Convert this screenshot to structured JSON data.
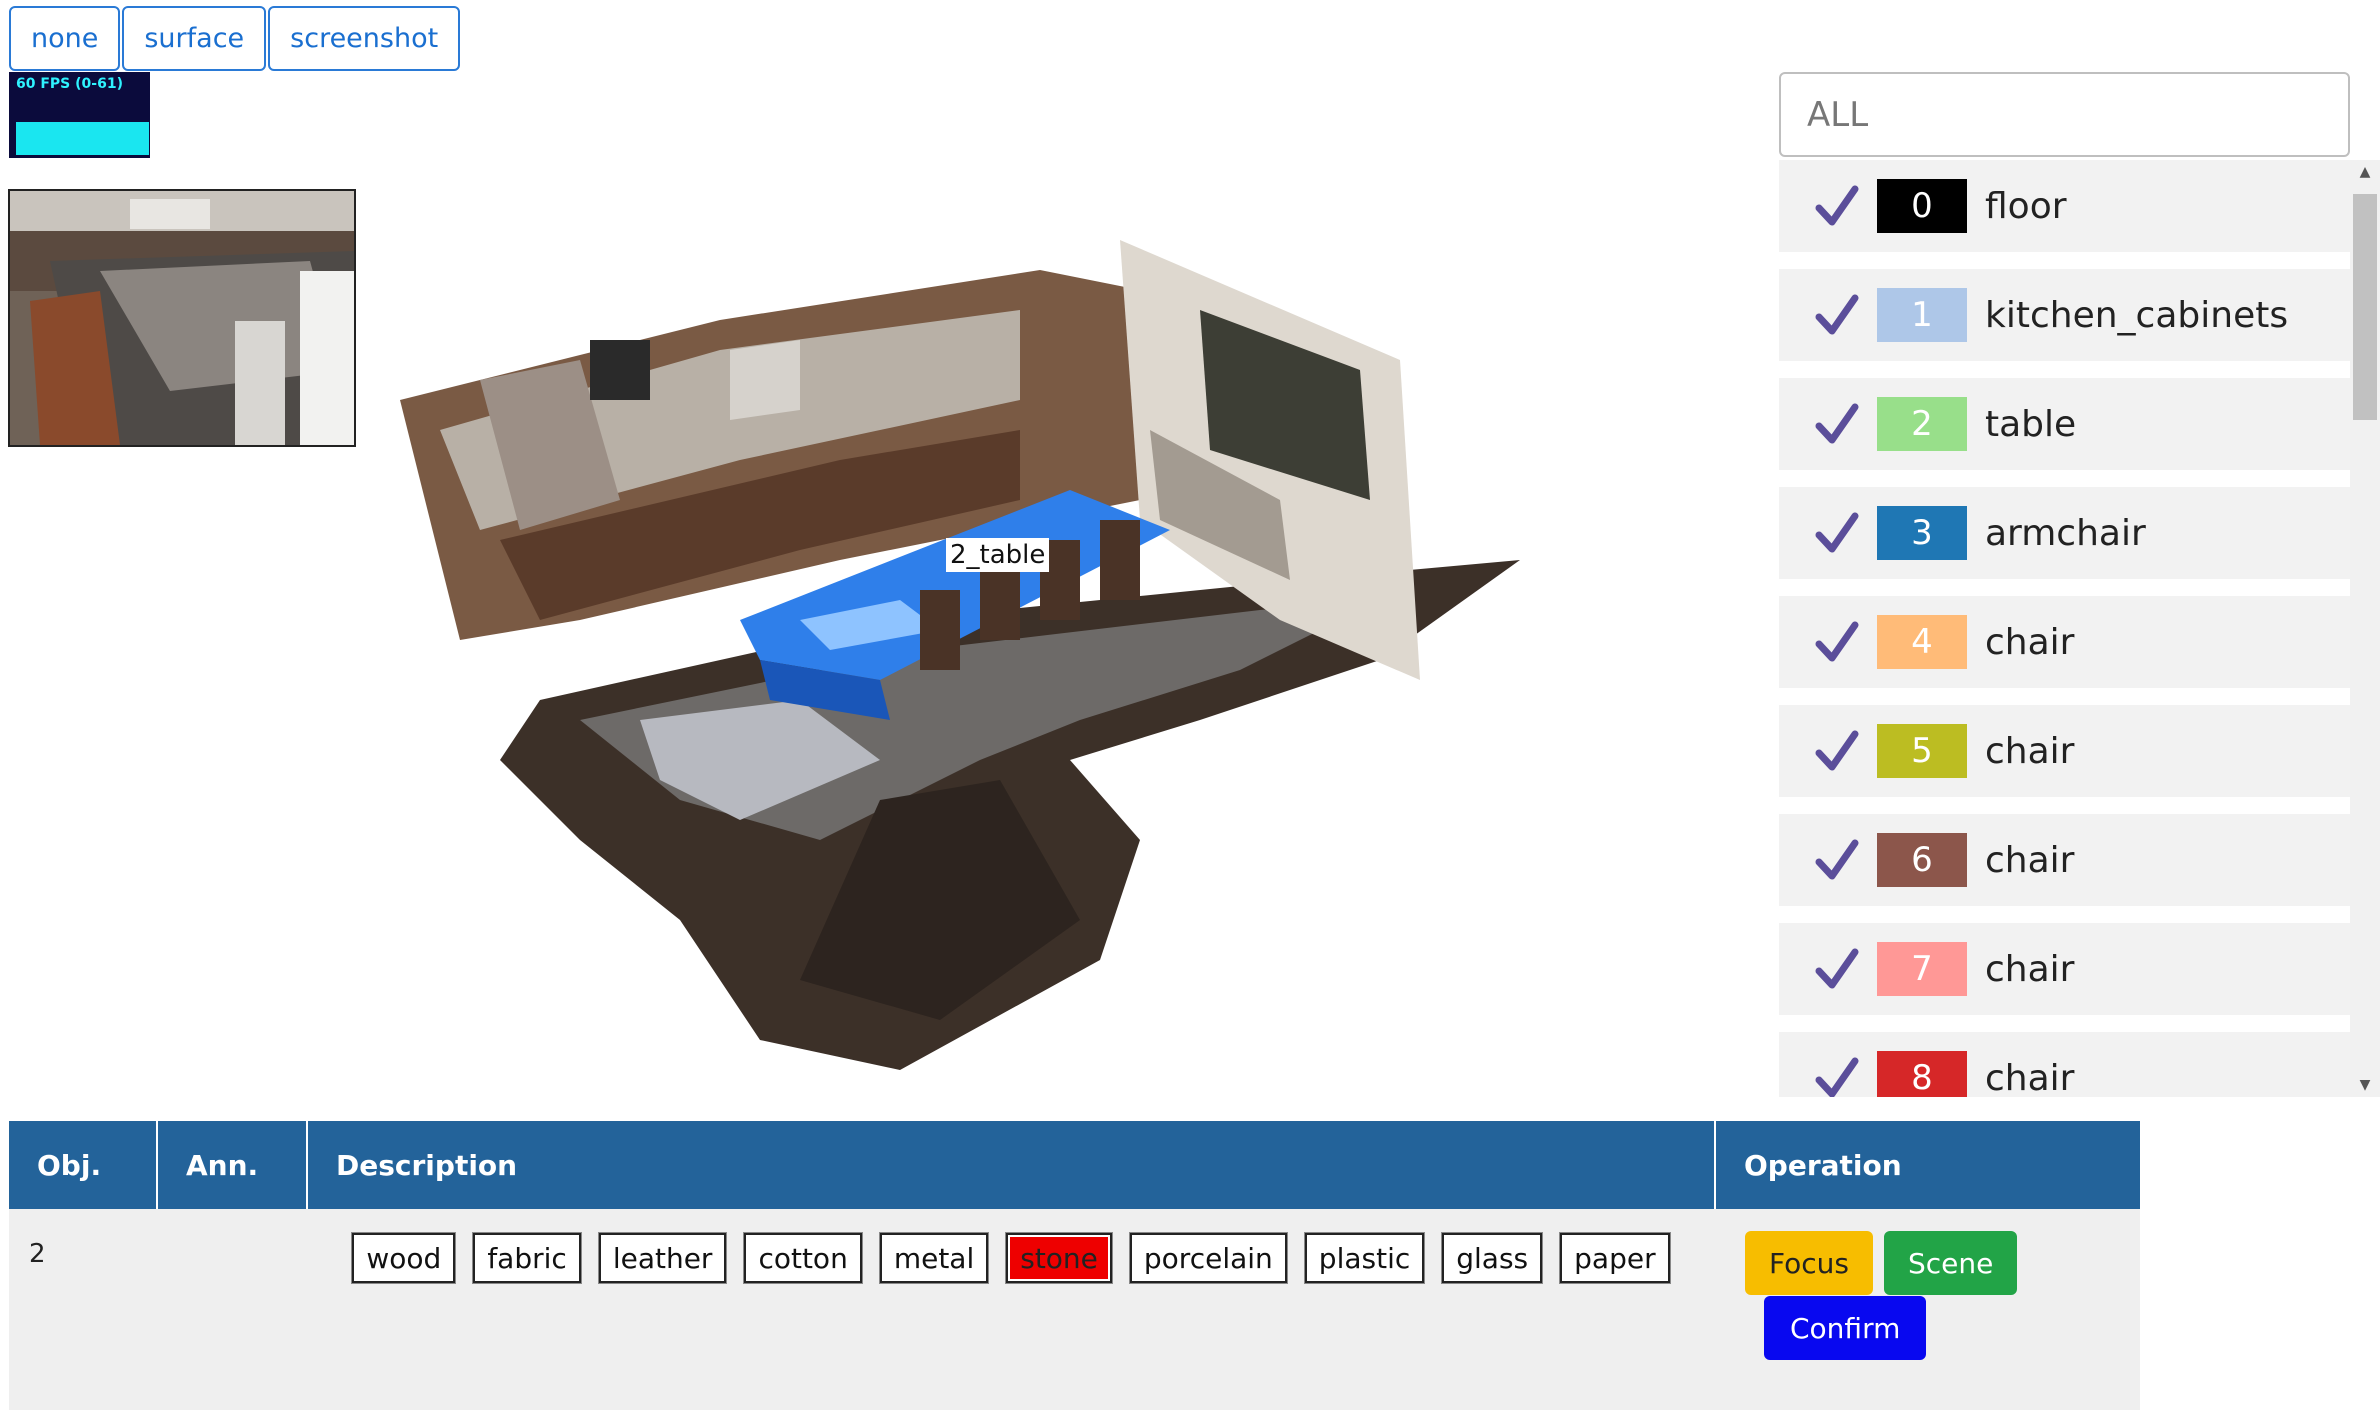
{
  "toolbar": {
    "buttons": [
      {
        "label": "none"
      },
      {
        "label": "surface"
      },
      {
        "label": "screenshot"
      }
    ]
  },
  "fps_meter": {
    "text": "60 FPS (0-61)"
  },
  "viewer": {
    "object_label": "2_table"
  },
  "search": {
    "placeholder": "ALL"
  },
  "labels": [
    {
      "index": "0",
      "name": "floor",
      "color": "#000000",
      "checked": true
    },
    {
      "index": "1",
      "name": "kitchen_cabinets",
      "color": "#aec7e8",
      "checked": true
    },
    {
      "index": "2",
      "name": "table",
      "color": "#98df8a",
      "checked": true
    },
    {
      "index": "3",
      "name": "armchair",
      "color": "#1f77b4",
      "checked": true
    },
    {
      "index": "4",
      "name": "chair",
      "color": "#ffbb78",
      "checked": true
    },
    {
      "index": "5",
      "name": "chair",
      "color": "#bcbd22",
      "checked": true
    },
    {
      "index": "6",
      "name": "chair",
      "color": "#8c564b",
      "checked": true
    },
    {
      "index": "7",
      "name": "chair",
      "color": "#ff9896",
      "checked": true
    },
    {
      "index": "8",
      "name": "chair",
      "color": "#d62728",
      "checked": true
    }
  ],
  "table": {
    "headers": {
      "obj": "Obj.",
      "ann": "Ann.",
      "description": "Description",
      "operation": "Operation"
    },
    "row": {
      "obj": "2",
      "ann": "",
      "materials": [
        "wood",
        "fabric",
        "leather",
        "cotton",
        "metal",
        "stone",
        "porcelain",
        "plastic",
        "glass",
        "paper"
      ],
      "selected_material": "stone",
      "operations": {
        "focus": "Focus",
        "scene": "Scene",
        "confirm": "Confirm"
      }
    }
  },
  "colors": {
    "header_blue": "#23639a",
    "accent_blue": "#1a6fd0",
    "selected_red": "#ee0000",
    "focus_yellow": "#f7bd00",
    "scene_green": "#22a447",
    "confirm_blue": "#0808f0",
    "check_purple": "#5b4e9a"
  }
}
